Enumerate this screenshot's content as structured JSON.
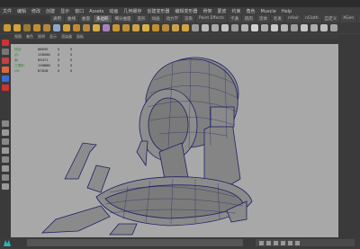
{
  "app": {
    "menu": [
      "文件",
      "编辑",
      "修改",
      "创建",
      "显示",
      "窗口",
      "Assets",
      "动画",
      "几何缓存",
      "创建变形器",
      "编辑变形器",
      "骨架",
      "蒙皮",
      "约束",
      "角色",
      "Muscle",
      "Help"
    ],
    "shelf_tabs": [
      "通用",
      "曲线",
      "曲面",
      "多边形",
      "细分曲面",
      "变形",
      "动画",
      "动力学",
      "渲染",
      "Paint Effects",
      "卡通",
      "肌肉",
      "流体",
      "毛发",
      "nHair",
      "nCloth",
      "自定义",
      "XGen",
      "Bifrost",
      "MASH",
      "运动图形",
      "TURTLE"
    ],
    "active_shelf_tab": "多边形",
    "panel_menu": [
      "视图",
      "着色",
      "照明",
      "显示",
      "渲染器",
      "面板"
    ]
  },
  "hud": {
    "rows": [
      {
        "label": "顶点:",
        "v1": "68830",
        "v2": "0",
        "v3": "0"
      },
      {
        "label": "边:",
        "v1": "138066",
        "v2": "0",
        "v3": "0"
      },
      {
        "label": "面:",
        "v1": "69471",
        "v2": "0",
        "v3": "0"
      },
      {
        "label": "三角形:",
        "v1": "136868",
        "v2": "0",
        "v3": "0"
      },
      {
        "label": "UV:",
        "v1": "87818",
        "v2": "0",
        "v3": "0"
      }
    ]
  },
  "colors": {
    "viewport_bg": "#a8a8a8",
    "wire": "#1a1f66",
    "model": "#7d7d7d"
  }
}
